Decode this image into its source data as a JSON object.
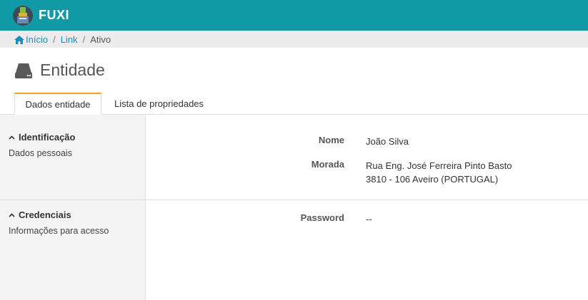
{
  "app": {
    "brand": "FUXI"
  },
  "breadcrumb": {
    "home": "Início",
    "link": "Link",
    "current": "Ativo",
    "sep": "/"
  },
  "page": {
    "title": "Entidade"
  },
  "tabs": [
    {
      "label": "Dados entidade",
      "active": true
    },
    {
      "label": "Lista de propriedades",
      "active": false
    }
  ],
  "sections": {
    "identificacao": {
      "title": "Identificação",
      "subtitle": "Dados pessoais",
      "fields": {
        "nome": {
          "label": "Nome",
          "value": "João Silva"
        },
        "morada": {
          "label": "Morada",
          "line1": "Rua Eng. José Ferreira Pinto Basto",
          "line2": "3810 - 106 Aveiro (PORTUGAL)"
        }
      }
    },
    "credenciais": {
      "title": "Credenciais",
      "subtitle": "Informações para acesso",
      "fields": {
        "password": {
          "label": "Password",
          "value": "--"
        }
      }
    }
  },
  "colors": {
    "topbar": "#0f9aa6",
    "tab_accent": "#f0a31e",
    "link": "#1a8cbf"
  },
  "icons": [
    "fuxi-logo-icon",
    "home-icon",
    "hard-drive-icon",
    "chevron-up-icon"
  ]
}
